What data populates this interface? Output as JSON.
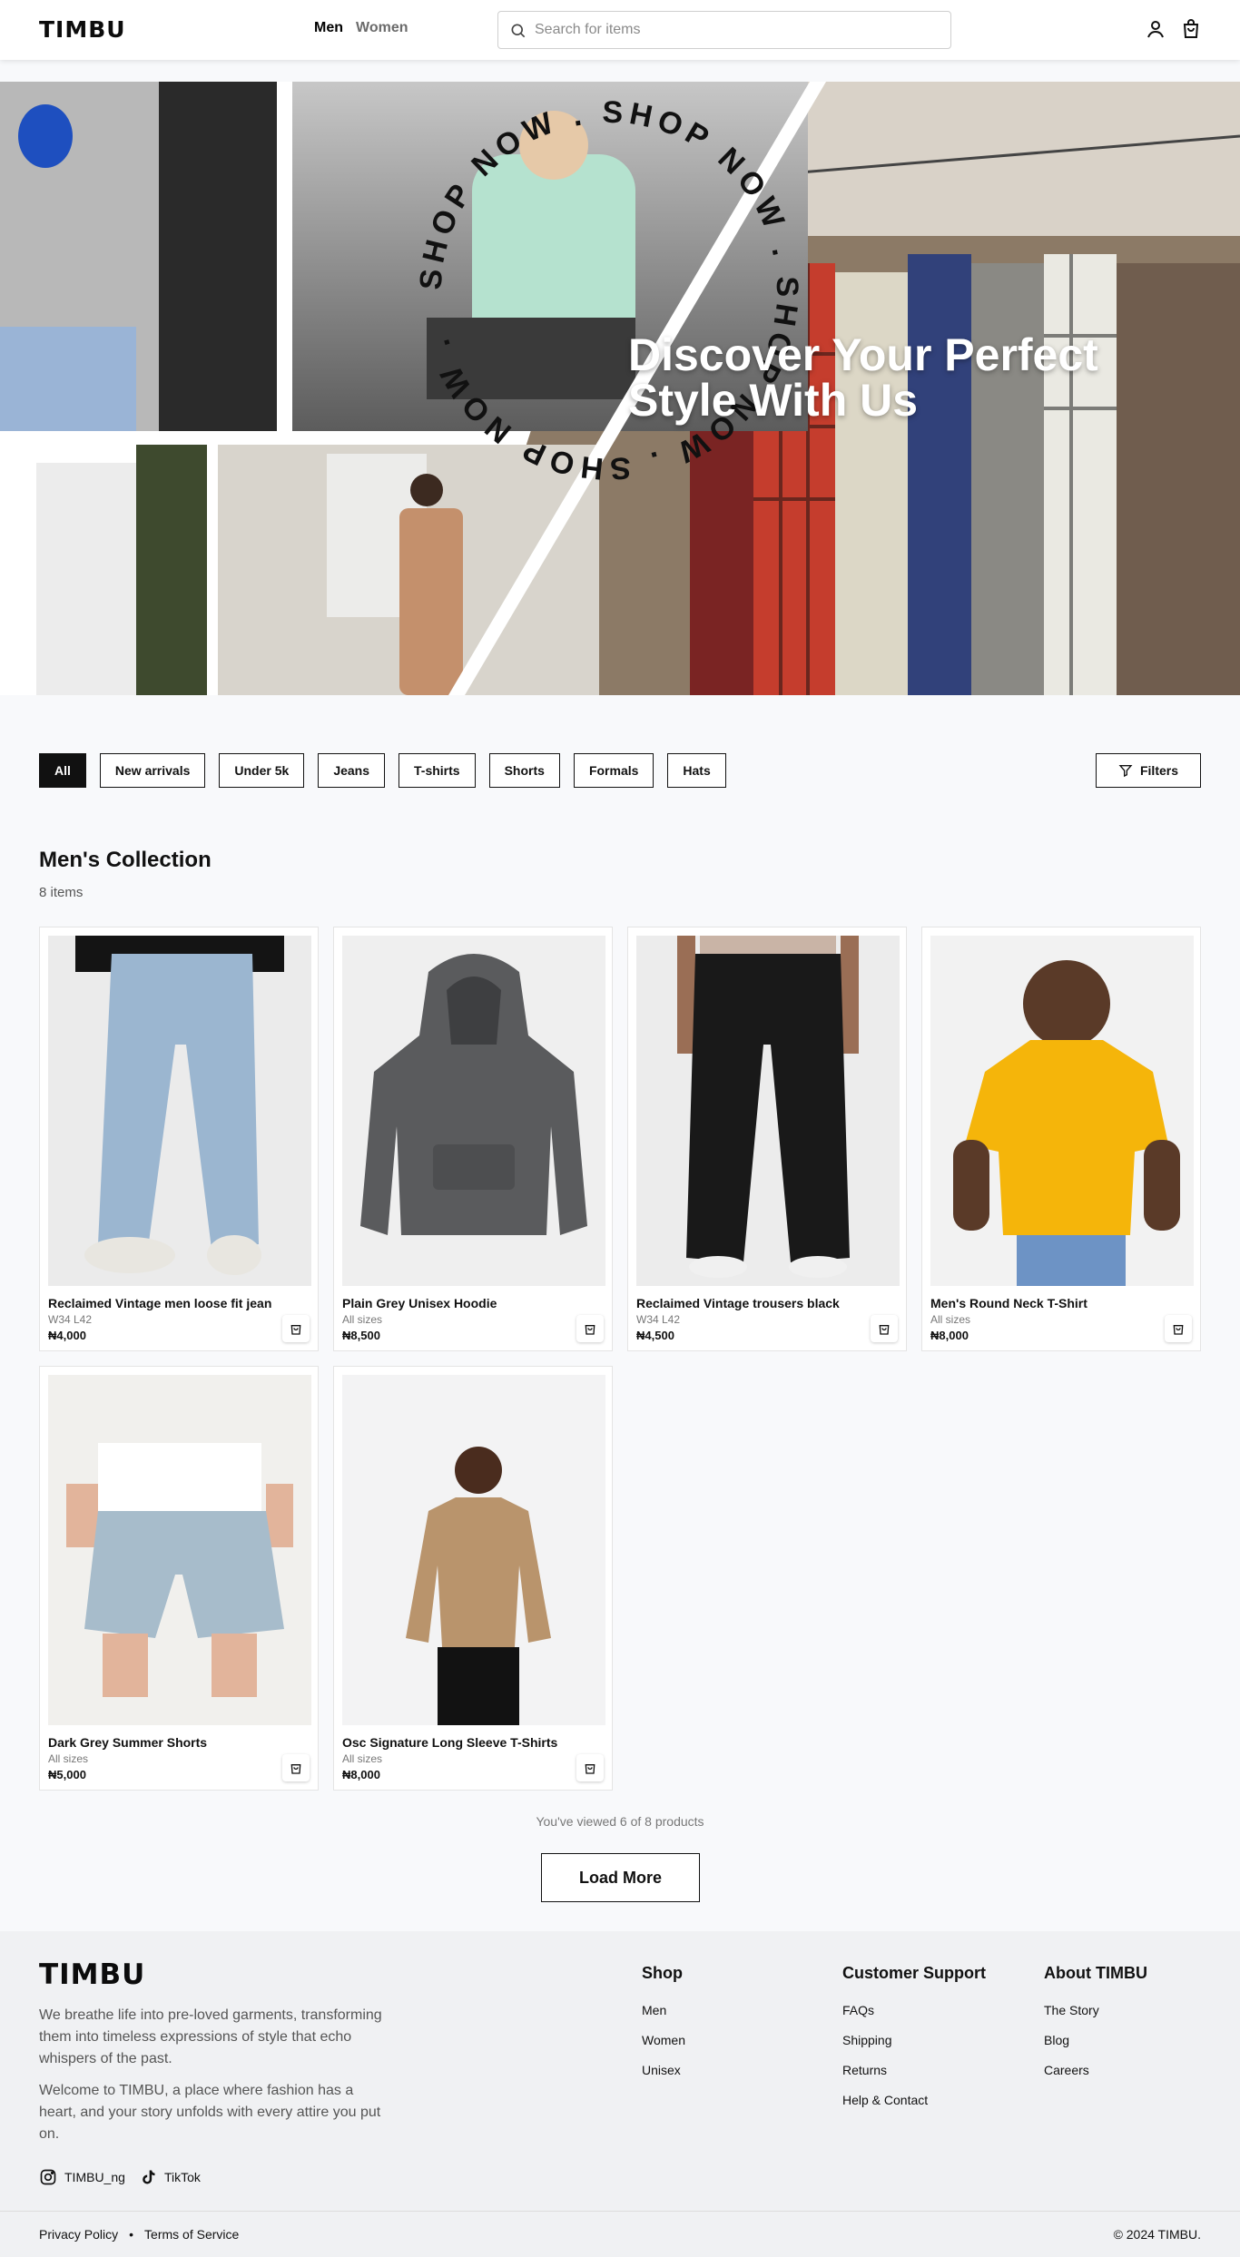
{
  "header": {
    "logo": "TIMBU",
    "nav": [
      "Men",
      "Women"
    ],
    "search_placeholder": "Search for items"
  },
  "hero": {
    "title": "Discover Your Perfect Style With Us",
    "badge_text": "SHOP NOW . SHOP NOW . SHOP NOW . SHOP NOW . "
  },
  "filters": {
    "chips": [
      "All",
      "New arrivals",
      "Under 5k",
      "Jeans",
      "T-shirts",
      "Shorts",
      "Formals",
      "Hats"
    ],
    "button": "Filters"
  },
  "collection": {
    "title": "Men's Collection",
    "count": "8 items",
    "products": [
      {
        "name": "Reclaimed Vintage men loose fit jean",
        "size": "W34 L42",
        "price": "₦4,000"
      },
      {
        "name": "Plain Grey Unisex Hoodie",
        "size": "All sizes",
        "price": "₦8,500"
      },
      {
        "name": "Reclaimed Vintage trousers black",
        "size": "W34 L42",
        "price": "₦4,500"
      },
      {
        "name": "Men's Round Neck T-Shirt",
        "size": "All sizes",
        "price": "₦8,000"
      },
      {
        "name": "Dark Grey Summer Shorts",
        "size": "All sizes",
        "price": "₦5,000"
      },
      {
        "name": "Osc Signature Long Sleeve T-Shirts",
        "size": "All sizes",
        "price": "₦8,000"
      }
    ],
    "viewed_text": "You've viewed 6 of 8 products",
    "load_more": "Load More"
  },
  "footer": {
    "logo": "TIMBU",
    "para1": "We breathe life into pre-loved garments, transforming them into timeless expressions of style that echo whispers of the past.",
    "para2": "Welcome to TIMBU, a place where fashion has a heart, and your story unfolds with every attire you put on.",
    "social": [
      "TIMBU_ng",
      "TikTok"
    ],
    "columns": [
      {
        "title": "Shop",
        "links": [
          "Men",
          "Women",
          "Unisex"
        ]
      },
      {
        "title": "Customer Support",
        "links": [
          "FAQs",
          "Shipping",
          "Returns",
          "Help & Contact"
        ]
      },
      {
        "title": "About TIMBU",
        "links": [
          "The Story",
          "Blog",
          "Careers"
        ]
      }
    ],
    "legal": [
      "Privacy Policy",
      "Terms of Service"
    ],
    "legal_separator": "•",
    "copyright": "© 2024 TIMBU."
  },
  "icons": [
    "search-icon",
    "user-icon",
    "cart-icon",
    "filter-icon",
    "bag-icon",
    "instagram-icon",
    "tiktok-icon"
  ]
}
